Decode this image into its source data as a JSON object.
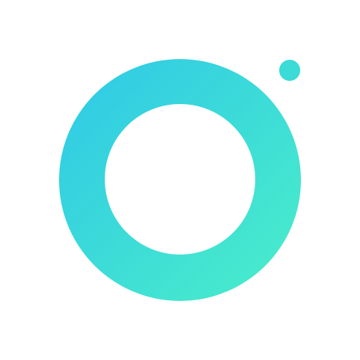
{
  "icon": {
    "name": "ring-logo-icon",
    "colors": {
      "background": "#ffffff",
      "gradient_start": "#2ec8e8",
      "gradient_end": "#4aefc8",
      "dot": "#3bdbd8"
    }
  }
}
